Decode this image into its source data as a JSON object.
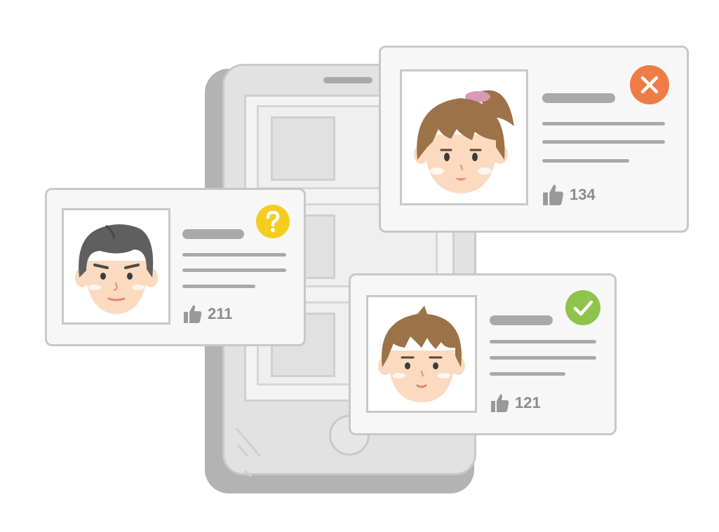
{
  "phone": {},
  "cards": {
    "man": {
      "likes": "211",
      "status_icon": "question-icon",
      "status_color": "#f5cd20"
    },
    "girl": {
      "likes": "134",
      "status_icon": "close-icon",
      "status_color": "#ef7c45"
    },
    "boy": {
      "likes": "121",
      "status_icon": "check-icon",
      "status_color": "#8fc34b"
    }
  },
  "colors": {
    "skin": "#fbdac0",
    "hair_gray": "#5f5f5f",
    "hair_brown": "#9c7248",
    "card_border": "#c8c8c8",
    "text_gray": "#8c8c8c"
  }
}
